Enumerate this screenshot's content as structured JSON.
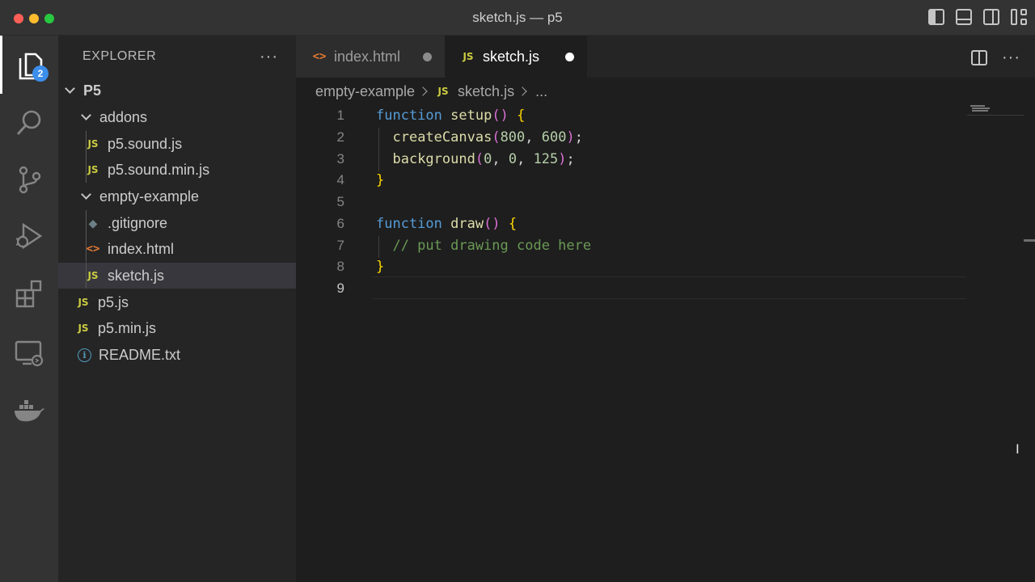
{
  "window": {
    "title": "sketch.js — p5"
  },
  "activity": {
    "explorer_badge": "2"
  },
  "sidebar": {
    "title": "EXPLORER",
    "more": "···",
    "tree": [
      {
        "label": "P5",
        "type": "folder"
      },
      {
        "label": "addons",
        "type": "folder"
      },
      {
        "label": "p5.sound.js",
        "type": "js"
      },
      {
        "label": "p5.sound.min.js",
        "type": "js"
      },
      {
        "label": "empty-example",
        "type": "folder"
      },
      {
        "label": ".gitignore",
        "type": "git"
      },
      {
        "label": "index.html",
        "type": "html"
      },
      {
        "label": "sketch.js",
        "type": "js",
        "selected": true
      },
      {
        "label": "p5.js",
        "type": "js"
      },
      {
        "label": "p5.min.js",
        "type": "js"
      },
      {
        "label": "README.txt",
        "type": "info"
      }
    ]
  },
  "tabs": [
    {
      "label": "index.html",
      "icon": "<>"
    },
    {
      "label": "sketch.js",
      "icon": "JS"
    }
  ],
  "breadcrumb": {
    "folder": "empty-example",
    "file": "sketch.js",
    "more": "..."
  },
  "editor": {
    "line_numbers": [
      "1",
      "2",
      "3",
      "4",
      "5",
      "6",
      "7",
      "8",
      "9"
    ],
    "lines": [
      "function setup() {",
      "  createCanvas(800, 600);",
      "  background(0, 0, 125);",
      "}",
      "",
      "function draw() {",
      "  // put drawing code here",
      "}",
      ""
    ]
  },
  "colors": {
    "keyword": "#569cd6",
    "function": "#dcdcaa",
    "number": "#b5cea8",
    "comment": "#6a9955",
    "bracket": "#ffd700",
    "badge": "#3b8eea"
  }
}
